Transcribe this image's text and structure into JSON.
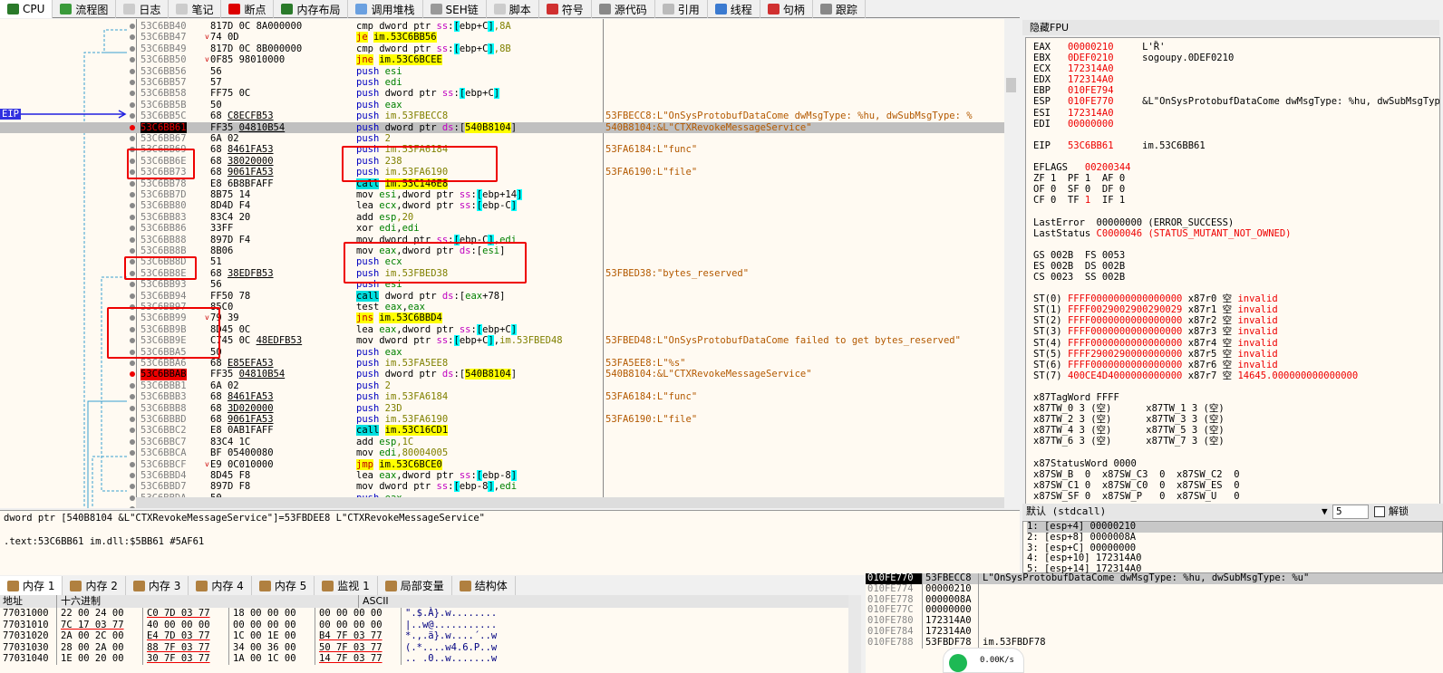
{
  "tabs": [
    {
      "label": "CPU",
      "icon": "cpu-icon",
      "color": "#2a7a2a"
    },
    {
      "label": "流程图",
      "icon": "tree-icon",
      "color": "#3a9a3a"
    },
    {
      "label": "日志",
      "icon": "log-icon",
      "color": "#ccc"
    },
    {
      "label": "笔记",
      "icon": "notes-icon",
      "color": "#ccc"
    },
    {
      "label": "断点",
      "icon": "breakpoint-icon",
      "color": "#d00"
    },
    {
      "label": "内存布局",
      "icon": "memory-map-icon",
      "color": "#2a7a2a"
    },
    {
      "label": "调用堆栈",
      "icon": "call-stack-icon",
      "color": "#6aa0e0"
    },
    {
      "label": "SEH链",
      "icon": "seh-icon",
      "color": "#999"
    },
    {
      "label": "脚本",
      "icon": "script-icon",
      "color": "#ccc"
    },
    {
      "label": "符号",
      "icon": "symbol-icon",
      "color": "#d03030"
    },
    {
      "label": "源代码",
      "icon": "source-icon",
      "color": "#888"
    },
    {
      "label": "引用",
      "icon": "search-icon",
      "color": "#bbb"
    },
    {
      "label": "线程",
      "icon": "thread-icon",
      "color": "#3a7ad0"
    },
    {
      "label": "句柄",
      "icon": "handle-icon",
      "color": "#d03030"
    },
    {
      "label": "跟踪",
      "icon": "trace-icon",
      "color": "#888"
    }
  ],
  "eip_label": "EIP",
  "disasm": [
    {
      "a": "53C6BB40",
      "b": "817D 0C 8A000000",
      "i": "cmp dword ptr ss:[ebp+C],8A",
      "c": ""
    },
    {
      "a": "53C6BB47",
      "b": "74 0D",
      "i": "je im.53C6BB56",
      "c": "",
      "j": true
    },
    {
      "a": "53C6BB49",
      "b": "817D 0C 8B000000",
      "i": "cmp dword ptr ss:[ebp+C],8B",
      "c": ""
    },
    {
      "a": "53C6BB50",
      "b": "0F85 98010000",
      "i": "jne im.53C6BCEE",
      "c": "",
      "j": true
    },
    {
      "a": "53C6BB56",
      "b": "56",
      "i": "push esi",
      "c": ""
    },
    {
      "a": "53C6BB57",
      "b": "57",
      "i": "push edi",
      "c": ""
    },
    {
      "a": "53C6BB58",
      "b": "FF75 0C",
      "i": "push dword ptr ss:[ebp+C]",
      "c": ""
    },
    {
      "a": "53C6BB5B",
      "b": "50",
      "i": "push eax",
      "c": ""
    },
    {
      "a": "53C6BB5C",
      "b": "68 C8ECFB53",
      "i": "push im.53FBECC8",
      "c": "53FBECC8:L\"OnSysProtobufDataCome dwMsgType: %hu, dwSubMsgType: %"
    },
    {
      "a": "53C6BB61",
      "b": "FF35 04810B54",
      "i": "push dword ptr ds:[540B8104]",
      "c": "540B8104:&L\"CTXRevokeMessageService\"",
      "eip": true
    },
    {
      "a": "53C6BB67",
      "b": "6A 02",
      "i": "push 2",
      "c": ""
    },
    {
      "a": "53C6BB69",
      "b": "68 8461FA53",
      "i": "push im.53FA6184",
      "c": "53FA6184:L\"func\""
    },
    {
      "a": "53C6BB6E",
      "b": "68 38020000",
      "i": "push 238",
      "c": ""
    },
    {
      "a": "53C6BB73",
      "b": "68 9061FA53",
      "i": "push im.53FA6190",
      "c": "53FA6190:L\"file\""
    },
    {
      "a": "53C6BB78",
      "b": "E8 6B8BFAFF",
      "i": "call im.53C146E8",
      "c": ""
    },
    {
      "a": "53C6BB7D",
      "b": "8B75 14",
      "i": "mov esi,dword ptr ss:[ebp+14]",
      "c": ""
    },
    {
      "a": "53C6BB80",
      "b": "8D4D F4",
      "i": "lea ecx,dword ptr ss:[ebp-C]",
      "c": ""
    },
    {
      "a": "53C6BB83",
      "b": "83C4 20",
      "i": "add esp,20",
      "c": ""
    },
    {
      "a": "53C6BB86",
      "b": "33FF",
      "i": "xor edi,edi",
      "c": ""
    },
    {
      "a": "53C6BB88",
      "b": "897D F4",
      "i": "mov dword ptr ss:[ebp-C],edi",
      "c": ""
    },
    {
      "a": "53C6BB8B",
      "b": "8B06",
      "i": "mov eax,dword ptr ds:[esi]",
      "c": ""
    },
    {
      "a": "53C6BB8D",
      "b": "51",
      "i": "push ecx",
      "c": ""
    },
    {
      "a": "53C6BB8E",
      "b": "68 38EDFB53",
      "i": "push im.53FBED38",
      "c": "53FBED38:\"bytes_reserved\""
    },
    {
      "a": "53C6BB93",
      "b": "56",
      "i": "push esi",
      "c": ""
    },
    {
      "a": "53C6BB94",
      "b": "FF50 78",
      "i": "call dword ptr ds:[eax+78]",
      "c": ""
    },
    {
      "a": "53C6BB97",
      "b": "85C0",
      "i": "test eax,eax",
      "c": ""
    },
    {
      "a": "53C6BB99",
      "b": "79 39",
      "i": "jns im.53C6BBD4",
      "c": "",
      "j": true
    },
    {
      "a": "53C6BB9B",
      "b": "8D45 0C",
      "i": "lea eax,dword ptr ss:[ebp+C]",
      "c": ""
    },
    {
      "a": "53C6BB9E",
      "b": "C745 0C 48EDFB53",
      "i": "mov dword ptr ss:[ebp+C],im.53FBED48",
      "c": "53FBED48:L\"OnSysProtobufDataCome failed to get bytes_reserved\""
    },
    {
      "a": "53C6BBA5",
      "b": "50",
      "i": "push eax",
      "c": ""
    },
    {
      "a": "53C6BBA6",
      "b": "68 E85EFA53",
      "i": "push im.53FA5EE8",
      "c": "53FA5EE8:L\"%s\""
    },
    {
      "a": "53C6BBAB",
      "b": "FF35 04810B54",
      "i": "push dword ptr ds:[540B8104]",
      "c": "540B8104:&L\"CTXRevokeMessageService\"",
      "bp": true
    },
    {
      "a": "53C6BBB1",
      "b": "6A 02",
      "i": "push 2",
      "c": ""
    },
    {
      "a": "53C6BBB3",
      "b": "68 8461FA53",
      "i": "push im.53FA6184",
      "c": "53FA6184:L\"func\""
    },
    {
      "a": "53C6BBB8",
      "b": "68 3D020000",
      "i": "push 23D",
      "c": ""
    },
    {
      "a": "53C6BBBD",
      "b": "68 9061FA53",
      "i": "push im.53FA6190",
      "c": "53FA6190:L\"file\""
    },
    {
      "a": "53C6BBC2",
      "b": "E8 0AB1FAFF",
      "i": "call im.53C16CD1",
      "c": ""
    },
    {
      "a": "53C6BBC7",
      "b": "83C4 1C",
      "i": "add esp,1C",
      "c": ""
    },
    {
      "a": "53C6BBCA",
      "b": "BF 05400080",
      "i": "mov edi,80004005",
      "c": ""
    },
    {
      "a": "53C6BBCF",
      "b": "E9 0C010000",
      "i": "jmp im.53C6BCE0",
      "c": "",
      "j": true
    },
    {
      "a": "53C6BBD4",
      "b": "8D45 F8",
      "i": "lea eax,dword ptr ss:[ebp-8]",
      "c": ""
    },
    {
      "a": "53C6BBD7",
      "b": "897D F8",
      "i": "mov dword ptr ss:[ebp-8],edi",
      "c": ""
    },
    {
      "a": "53C6BBDA",
      "b": "50",
      "i": "push eax",
      "c": ""
    },
    {
      "a": "53C6BBDB",
      "b": "E8 9105FEFF",
      "i": "call im.53C4C171",
      "c": ""
    },
    {
      "a": "53C6BBE0",
      "b": "59",
      "i": "pop ecx",
      "c": ""
    },
    {
      "a": "53C6BBE1",
      "b": "85C0",
      "i": "test eax,eax",
      "c": ""
    },
    {
      "a": "53C6BBE3",
      "b": "75 39",
      "i": "jne im.53C6BC1E",
      "c": "",
      "j": true
    },
    {
      "a": "53C6BBE5",
      "b": "8D45 0C",
      "i": "lea eax,dword ptr ss:[ebp+C]",
      "c": ""
    }
  ],
  "info": {
    "line1": "dword ptr [540B8104 &L\"CTXRevokeMessageService\"]=53FBDEE8 L\"CTXRevokeMessageService\"",
    "line2": ".text:53C6BB61 im.dll:$5BB61 #5AF61"
  },
  "regs": {
    "header": "隐藏FPU",
    "gp": [
      [
        "EAX",
        "00000210",
        "L'Ȑ'"
      ],
      [
        "EBX",
        "0DEF0210",
        "sogoupy.0DEF0210"
      ],
      [
        "ECX",
        "172314A0",
        ""
      ],
      [
        "EDX",
        "172314A0",
        ""
      ],
      [
        "EBP",
        "010FE794",
        ""
      ],
      [
        "ESP",
        "010FE770",
        "&L\"OnSysProtobufDataCome dwMsgType: %hu, dwSubMsgType: %u\""
      ],
      [
        "ESI",
        "172314A0",
        ""
      ],
      [
        "EDI",
        "00000000",
        ""
      ]
    ],
    "eip": [
      "EIP",
      "53C6BB61",
      "im.53C6BB61"
    ],
    "eflags": [
      "EFLAGS",
      "00200344"
    ],
    "flags": [
      [
        "ZF",
        "1",
        "PF",
        "1",
        "AF",
        "0"
      ],
      [
        "OF",
        "0",
        "SF",
        "0",
        "DF",
        "0"
      ],
      [
        "CF",
        "0",
        "TF",
        "1",
        "IF",
        "1"
      ]
    ],
    "last_error": [
      "LastError",
      "00000000 (ERROR_SUCCESS)"
    ],
    "last_status": [
      "LastStatus",
      "C0000046 (STATUS_MUTANT_NOT_OWNED)"
    ],
    "segs": [
      "GS 002B  FS 0053",
      "ES 002B  DS 002B",
      "CS 0023  SS 002B"
    ],
    "st": [
      [
        "ST(0)",
        "FFFF0000000000000000",
        "x87r0 空",
        "invalid"
      ],
      [
        "ST(1)",
        "FFFF0029002900290029",
        "x87r1 空",
        "invalid"
      ],
      [
        "ST(2)",
        "FFFF0000000000000000",
        "x87r2 空",
        "invalid"
      ],
      [
        "ST(3)",
        "FFFF0000000000000000",
        "x87r3 空",
        "invalid"
      ],
      [
        "ST(4)",
        "FFFF0000000000000000",
        "x87r4 空",
        "invalid"
      ],
      [
        "ST(5)",
        "FFFF2900290000000000",
        "x87r5 空",
        "invalid"
      ],
      [
        "ST(6)",
        "FFFF0000000000000000",
        "x87r6 空",
        "invalid"
      ],
      [
        "ST(7)",
        "400CE4D4000000000000",
        "x87r7 空",
        "14645.000000000000000"
      ]
    ],
    "tagword": "x87TagWord FFFF",
    "tw": [
      "x87TW_0 3 (空)      x87TW_1 3 (空)",
      "x87TW_2 3 (空)      x87TW_3 3 (空)",
      "x87TW_4 3 (空)      x87TW_5 3 (空)",
      "x87TW_6 3 (空)      x87TW_7 3 (空)"
    ],
    "statusword": "x87StatusWord 0000",
    "sw": [
      "x87SW_B  0  x87SW_C3  0  x87SW_C2  0",
      "x87SW_C1 0  x87SW_C0  0  x87SW_ES  0",
      "x87SW_SF 0  x87SW_P   0  x87SW_U   0"
    ]
  },
  "callconv": {
    "selected": "默认 (stdcall)",
    "count": "5",
    "unlock_label": "解锁",
    "unlocked": false
  },
  "args": [
    "1: [esp+4] 00000210",
    "2: [esp+8] 0000008A",
    "3: [esp+C] 00000000",
    "4: [esp+10] 172314A0",
    "5: [esp+14] 172314A0"
  ],
  "memtabs": [
    {
      "label": "内存 1",
      "icon": "memory-icon"
    },
    {
      "label": "内存 2",
      "icon": "memory-icon"
    },
    {
      "label": "内存 3",
      "icon": "memory-icon"
    },
    {
      "label": "内存 4",
      "icon": "memory-icon"
    },
    {
      "label": "内存 5",
      "icon": "memory-icon"
    },
    {
      "label": "监视 1",
      "icon": "watch-icon"
    },
    {
      "label": "局部变量",
      "icon": "locals-icon"
    },
    {
      "label": "结构体",
      "icon": "struct-icon"
    }
  ],
  "mem": {
    "headers": [
      "地址",
      "十六进制",
      "ASCII"
    ],
    "rows": [
      [
        "77031000",
        "22 00 24 00",
        "C0 7D 03 77",
        "18 00 00 00",
        "00 00 00 00",
        "\".$.À}.w........"
      ],
      [
        "77031010",
        "7C 17 03 77",
        "40 00 00 00",
        "00 00 00 00",
        "00 00 00 00",
        "|..w@..........."
      ],
      [
        "77031020",
        "2A 00 2C 00",
        "E4 7D 03 77",
        "1C 00 1E 00",
        "B4 7F 03 77",
        "*.,.ä}.w....´..w"
      ],
      [
        "77031030",
        "28 00 2A 00",
        "88 7F 03 77",
        "34 00 36 00",
        "50 7F 03 77",
        "(.*....w4.6.P..w"
      ],
      [
        "77031040",
        "1E 00 20 00",
        "30 7F 03 77",
        "1A 00 1C 00",
        "14 7F 03 77",
        ".. .0..w.......w"
      ]
    ]
  },
  "stack": [
    [
      "010FE770",
      "53FBECC8",
      "L\"OnSysProtobufDataCome dwMsgType: %hu, dwSubMsgType: %u\""
    ],
    [
      "010FE774",
      "00000210",
      ""
    ],
    [
      "010FE778",
      "0000008A",
      ""
    ],
    [
      "010FE77C",
      "00000000",
      ""
    ],
    [
      "010FE780",
      "172314A0",
      ""
    ],
    [
      "010FE784",
      "172314A0",
      ""
    ],
    [
      "010FE788",
      "53FBDF78",
      "im.53FBDF78"
    ]
  ],
  "netspeed": "0.00K/s"
}
